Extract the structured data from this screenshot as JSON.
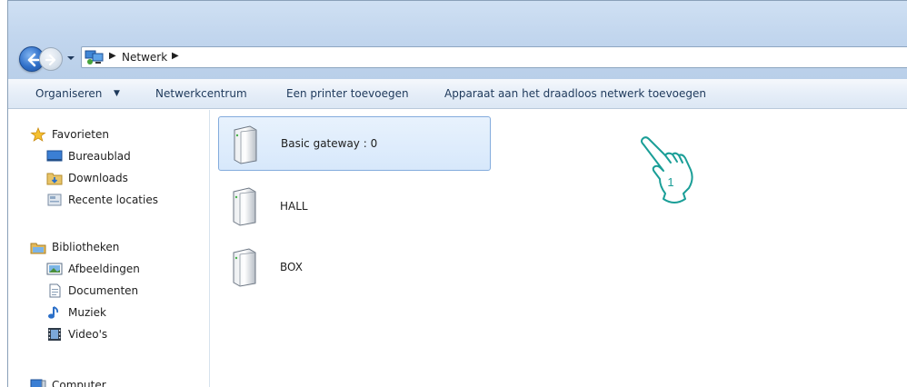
{
  "address": {
    "crumb": "Netwerk",
    "back_icon": "back-arrow-icon",
    "forward_icon": "forward-arrow-icon",
    "location_icon": "network-icon"
  },
  "commands": {
    "organize": "Organiseren",
    "network_center": "Netwerkcentrum",
    "add_printer": "Een printer toevoegen",
    "add_wireless": "Apparaat aan het draadloos netwerk toevoegen"
  },
  "navpane": {
    "favorites": "Favorieten",
    "desktop": "Bureaublad",
    "downloads": "Downloads",
    "recent": "Recente locaties",
    "libraries": "Bibliotheken",
    "pictures": "Afbeeldingen",
    "documents": "Documenten",
    "music": "Muziek",
    "videos": "Video's",
    "computer": "Computer"
  },
  "devices": [
    {
      "label": "Basic gateway : 0",
      "selected": true
    },
    {
      "label": "HALL",
      "selected": false
    },
    {
      "label": "BOX",
      "selected": false
    }
  ],
  "callout": {
    "number": "1",
    "icon": "pointing-hand-icon"
  },
  "colors": {
    "selection_bg": "#d7e8fb",
    "selection_border": "#84acdd",
    "callout_stroke": "#1a9e97",
    "command_text": "#1e395b"
  }
}
